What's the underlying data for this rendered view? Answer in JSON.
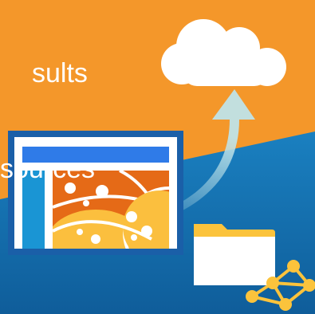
{
  "headline": {
    "line1": "sults",
    "line2": "sources"
  },
  "colors": {
    "orange_bg": "#f4972a",
    "blue_bg": "#1572b4",
    "cloud": "#ffffff",
    "window_bar": "#2f7be8",
    "window_side": "#1a95d4",
    "window_panel": "#e56a17",
    "yellow": "#fbbf3e",
    "folder": "#fbc33c"
  },
  "icons": [
    "cloud-icon",
    "upload-arrow-icon",
    "app-window-icon",
    "folder-icon",
    "network-graph-icon"
  ]
}
